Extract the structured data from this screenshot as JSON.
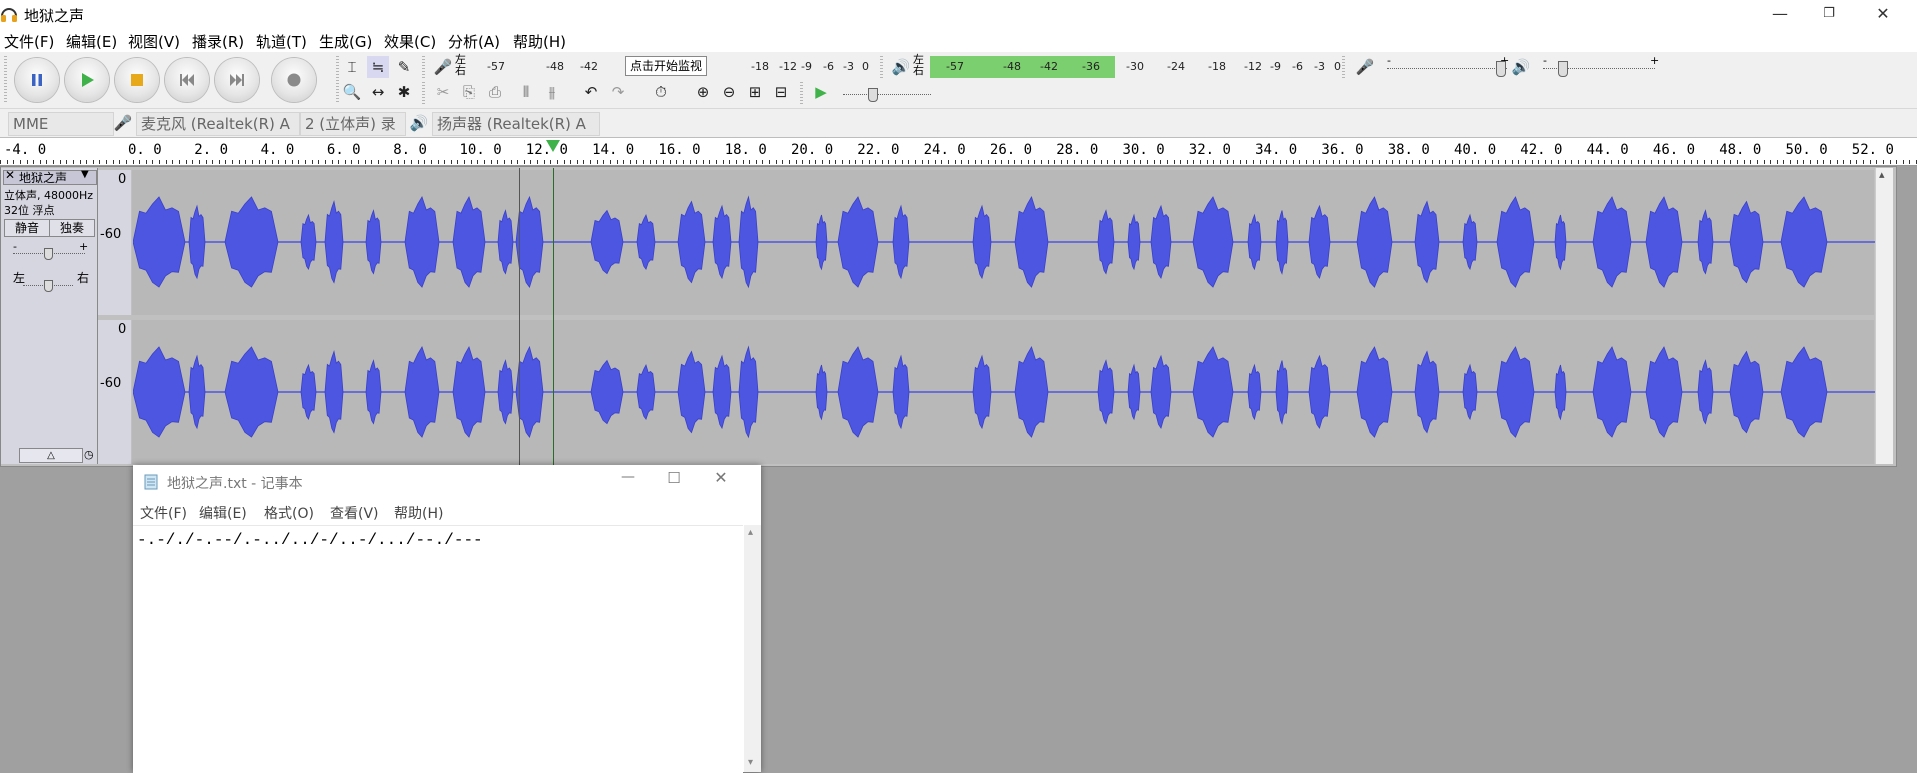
{
  "app": {
    "title": "地狱之声",
    "menu": [
      "文件(F)",
      "编辑(E)",
      "视图(V)",
      "播录(R)",
      "轨道(T)",
      "生成(G)",
      "效果(C)",
      "分析(A)",
      "帮助(H)"
    ]
  },
  "meters": {
    "rec_lr": "左\n右",
    "rec_scale": [
      "-57",
      "-48",
      "-42",
      "-18",
      "-12",
      "-9",
      "-6",
      "-3",
      "0"
    ],
    "rec_tooltip": "点击开始监视",
    "play_scale": [
      "-57",
      "-48",
      "-42",
      "-36",
      "-30",
      "-24",
      "-18",
      "-12",
      "-9",
      "-6",
      "-3",
      "0"
    ],
    "slider_minus": "-",
    "slider_plus": "+"
  },
  "devices": {
    "host": "MME",
    "input": "麦克风 (Realtek(R) A",
    "channels": "2 (立体声) 录",
    "output": "扬声器 (Realtek(R) A"
  },
  "ruler": {
    "labels": [
      "-4.0",
      "0.0",
      "2.0",
      "4.0",
      "6.0",
      "8.0",
      "10.0",
      "12.0",
      "14.0",
      "16.0",
      "18.0",
      "20.0",
      "22.0",
      "24.0",
      "26.0",
      "28.0",
      "30.0",
      "32.0",
      "34.0",
      "36.0",
      "38.0",
      "40.0",
      "42.0",
      "44.0",
      "46.0",
      "48.0",
      "50.0",
      "52.0"
    ]
  },
  "track": {
    "name": "地狱之声",
    "info_line1": "立体声, 48000Hz",
    "info_line2": "32位 浮点",
    "mute": "静音",
    "solo": "独奏",
    "gain_minus": "-",
    "gain_plus": "+",
    "pan_left": "左",
    "pan_right": "右",
    "scale_top": "0",
    "scale_mid": "-60"
  },
  "notepad": {
    "title": "地狱之声.txt - 记事本",
    "menu": [
      "文件(F)",
      "编辑(E)",
      "格式(O)",
      "查看(V)",
      "帮助(H)"
    ],
    "content": "-.-/./-.--/.-../../-/..-/.../--./---"
  },
  "colors": {
    "waveform": "#4d56e0",
    "waveform_edge": "#3a40c8",
    "meter_green": "#7ccf6e",
    "play_green": "#3fb34a"
  }
}
